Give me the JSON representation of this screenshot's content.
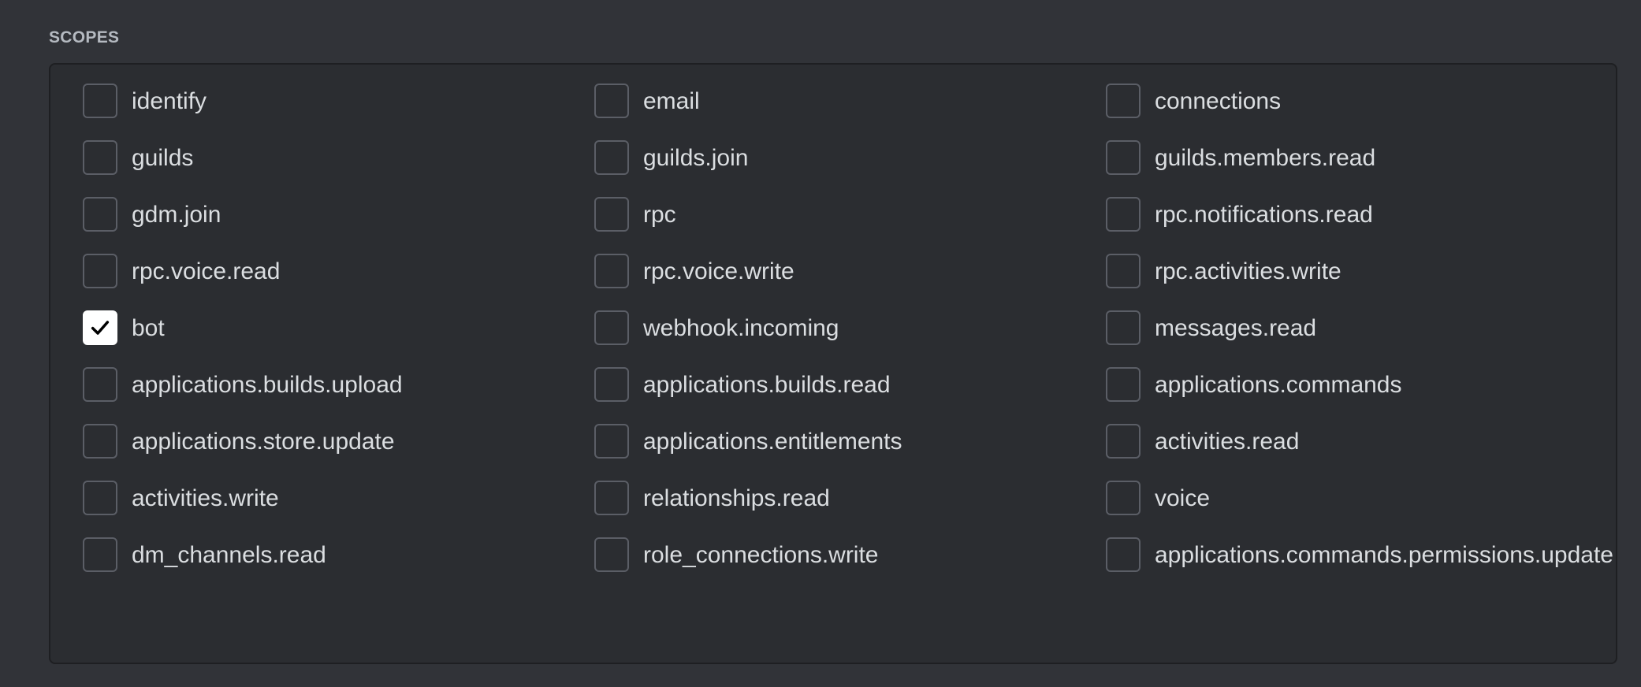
{
  "section": {
    "title": "SCOPES"
  },
  "scopes": [
    {
      "label": "identify",
      "checked": false
    },
    {
      "label": "email",
      "checked": false
    },
    {
      "label": "connections",
      "checked": false
    },
    {
      "label": "guilds",
      "checked": false
    },
    {
      "label": "guilds.join",
      "checked": false
    },
    {
      "label": "guilds.members.read",
      "checked": false
    },
    {
      "label": "gdm.join",
      "checked": false
    },
    {
      "label": "rpc",
      "checked": false
    },
    {
      "label": "rpc.notifications.read",
      "checked": false
    },
    {
      "label": "rpc.voice.read",
      "checked": false
    },
    {
      "label": "rpc.voice.write",
      "checked": false
    },
    {
      "label": "rpc.activities.write",
      "checked": false
    },
    {
      "label": "bot",
      "checked": true
    },
    {
      "label": "webhook.incoming",
      "checked": false
    },
    {
      "label": "messages.read",
      "checked": false
    },
    {
      "label": "applications.builds.upload",
      "checked": false
    },
    {
      "label": "applications.builds.read",
      "checked": false
    },
    {
      "label": "applications.commands",
      "checked": false
    },
    {
      "label": "applications.store.update",
      "checked": false
    },
    {
      "label": "applications.entitlements",
      "checked": false
    },
    {
      "label": "activities.read",
      "checked": false
    },
    {
      "label": "activities.write",
      "checked": false
    },
    {
      "label": "relationships.read",
      "checked": false
    },
    {
      "label": "voice",
      "checked": false
    },
    {
      "label": "dm_channels.read",
      "checked": false
    },
    {
      "label": "role_connections.write",
      "checked": false
    },
    {
      "label": "applications.commands.permissions.update",
      "checked": false
    }
  ],
  "icons": {
    "checked": "checkmark-icon"
  }
}
